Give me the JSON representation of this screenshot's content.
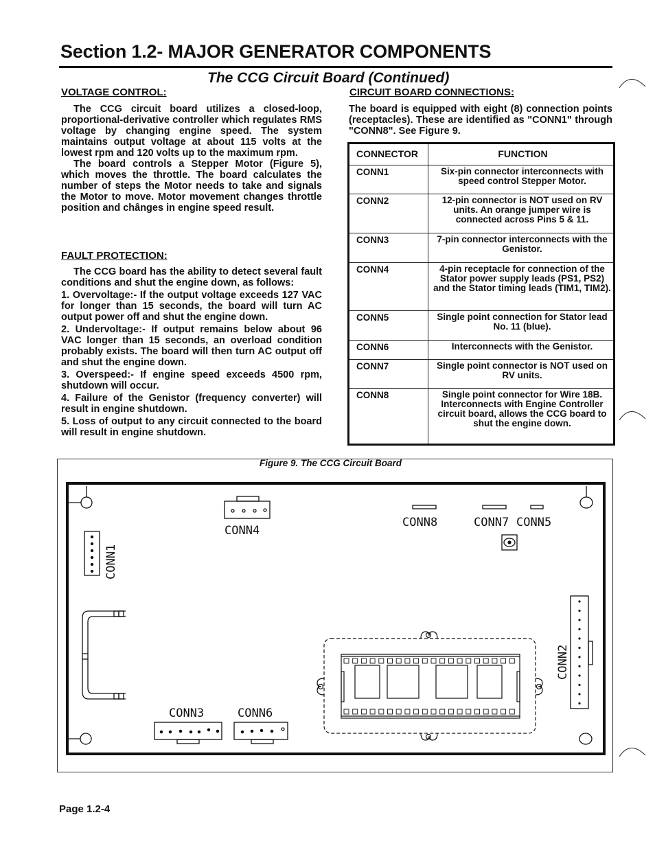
{
  "header": {
    "section_title": "Section 1.2- MAJOR GENERATOR COMPONENTS",
    "subtitle": "The CCG Circuit Board (Continued)"
  },
  "voltage_control": {
    "heading": "VOLTAGE CONTROL:",
    "paragraphs": [
      "The CCG circuit board utilizes a closed-loop, proportional-derivative controller which regulates RMS voltage by changing engine speed. The system maintains output voltage at about 115 volts at the lowest rpm and 120 volts up to the maximum rpm.",
      "The board controls a Stepper Motor (Figure 5), which moves the throttle. The board calculates the number of steps the Motor needs to take and signals the Motor to move. Motor movement changes throttle position and chânges in engine speed result."
    ]
  },
  "fault_protection": {
    "heading": "FAULT PROTECTION:",
    "intro": "The CCG board has the ability to detect several fault conditions and shut the engine down, as follows:",
    "items": [
      "1.  Overvoltage:- If the output voltage exceeds 127 VAC for longer than 15 seconds, the board will turn AC output power off and shut the engine down.",
      "2. Undervoltage:- If output remains below about 96 VAC longer than 15 seconds, an overload condition probably exists. The board will then turn AC output off and shut the engine down.",
      "3. Overspeed:- If engine speed exceeds 4500 rpm, shutdown will occur.",
      "4. Failure of the Genistor (frequency converter) will result in engine shutdown.",
      "5. Loss of output to any circuit connected to the board will result in engine shutdown."
    ]
  },
  "connections": {
    "heading": "CIRCUIT BOARD CONNECTIONS:",
    "intro": "The board is equipped with eight (8) connection points (receptacles). These are identified as \"CONN1\" through \"CONN8\".  See Figure 9.",
    "table": {
      "headers": [
        "CONNECTOR",
        "FUNCTION"
      ],
      "rows": [
        {
          "connector": "CONN1",
          "function": "Six-pin connector interconnects with speed control Stepper Motor."
        },
        {
          "connector": "CONN2",
          "function": "12-pin connector is NOT used on RV units. An orange jumper wire is connected across Pins 5 & 11."
        },
        {
          "connector": "CONN3",
          "function": "7-pin connector interconnects with the Genistor."
        },
        {
          "connector": "CONN4",
          "function": "4-pin receptacle for connection of the Stator power supply leads (PS1, PS2) and the Stator timing leads (TIM1, TIM2)."
        },
        {
          "connector": "CONN5",
          "function": "Single point connection for Stator lead No. 11 (blue)."
        },
        {
          "connector": "CONN6",
          "function": "Interconnects with the Genistor."
        },
        {
          "connector": "CONN7",
          "function": "Single point connector is NOT used on RV units."
        },
        {
          "connector": "CONN8",
          "function": "Single point connector for Wire 18B. Interconnects with Engine Controller circuit board, allows the CCG board to shut the engine down."
        }
      ]
    }
  },
  "figure": {
    "caption": "Figure 9. The CCG Circuit Board",
    "labels": {
      "conn1": "CONN1",
      "conn2": "CONN2",
      "conn3": "CONN3",
      "conn4": "CONN4",
      "conn5": "CONN5",
      "conn6": "CONN6",
      "conn7": "CONN7",
      "conn8": "CONN8"
    }
  },
  "footer": {
    "page_number": "Page 1.2-4"
  }
}
